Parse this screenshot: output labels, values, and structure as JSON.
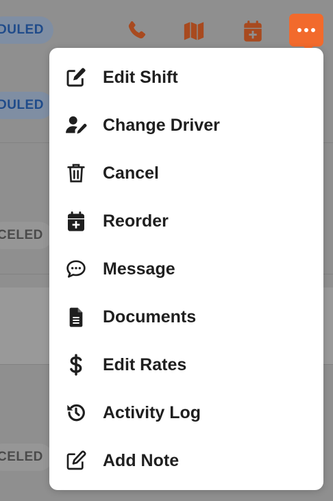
{
  "colors": {
    "accent": "#f26a2c",
    "top_icon": "#a84a1f",
    "overlay": "#8f8f8f",
    "menu_bg": "#ffffff",
    "menu_text": "#1f1f1f",
    "scheduled_badge_text": "#1f4b8a",
    "canceled_badge_text": "#4a4a4a"
  },
  "background": {
    "badges": [
      {
        "text": "DULED",
        "status": "scheduled"
      },
      {
        "text": "DULED",
        "status": "scheduled"
      },
      {
        "text": "CELED",
        "status": "canceled"
      },
      {
        "text": "CELED",
        "status": "canceled"
      }
    ]
  },
  "toolbar": {
    "icons": [
      "phone-icon",
      "map-icon",
      "calendar-add-icon",
      "more-icon"
    ]
  },
  "menu": {
    "items": [
      {
        "label": "Edit Shift",
        "icon": "edit-icon"
      },
      {
        "label": "Change Driver",
        "icon": "user-edit-icon"
      },
      {
        "label": "Cancel",
        "icon": "trash-icon"
      },
      {
        "label": "Reorder",
        "icon": "calendar-add-icon"
      },
      {
        "label": "Message",
        "icon": "chat-icon"
      },
      {
        "label": "Documents",
        "icon": "document-icon"
      },
      {
        "label": "Edit Rates",
        "icon": "dollar-icon"
      },
      {
        "label": "Activity Log",
        "icon": "history-icon"
      },
      {
        "label": "Add Note",
        "icon": "note-edit-icon"
      }
    ]
  }
}
